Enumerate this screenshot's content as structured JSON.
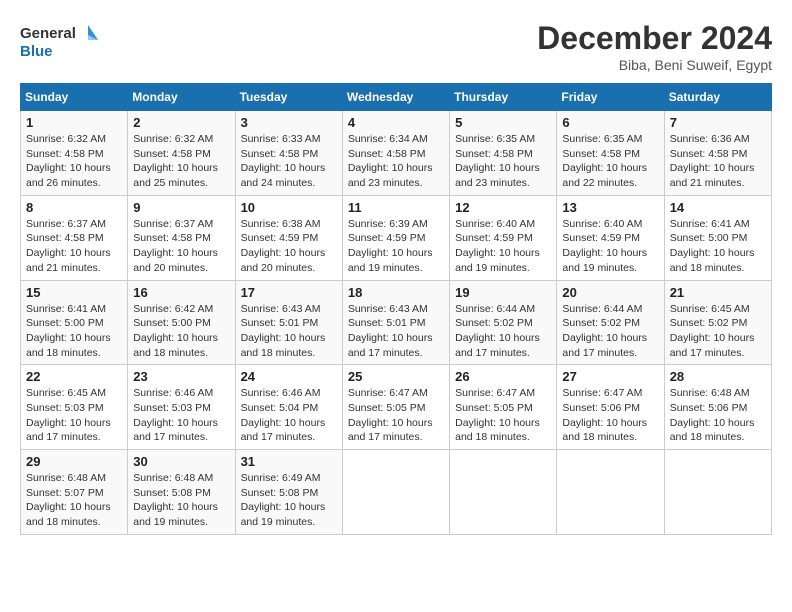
{
  "logo": {
    "line1": "General",
    "line2": "Blue"
  },
  "title": "December 2024",
  "location": "Biba, Beni Suweif, Egypt",
  "weekdays": [
    "Sunday",
    "Monday",
    "Tuesday",
    "Wednesday",
    "Thursday",
    "Friday",
    "Saturday"
  ],
  "weeks": [
    [
      {
        "day": "1",
        "sunrise": "6:32 AM",
        "sunset": "4:58 PM",
        "daylight": "10 hours and 26 minutes."
      },
      {
        "day": "2",
        "sunrise": "6:32 AM",
        "sunset": "4:58 PM",
        "daylight": "10 hours and 25 minutes."
      },
      {
        "day": "3",
        "sunrise": "6:33 AM",
        "sunset": "4:58 PM",
        "daylight": "10 hours and 24 minutes."
      },
      {
        "day": "4",
        "sunrise": "6:34 AM",
        "sunset": "4:58 PM",
        "daylight": "10 hours and 23 minutes."
      },
      {
        "day": "5",
        "sunrise": "6:35 AM",
        "sunset": "4:58 PM",
        "daylight": "10 hours and 23 minutes."
      },
      {
        "day": "6",
        "sunrise": "6:35 AM",
        "sunset": "4:58 PM",
        "daylight": "10 hours and 22 minutes."
      },
      {
        "day": "7",
        "sunrise": "6:36 AM",
        "sunset": "4:58 PM",
        "daylight": "10 hours and 21 minutes."
      }
    ],
    [
      {
        "day": "8",
        "sunrise": "6:37 AM",
        "sunset": "4:58 PM",
        "daylight": "10 hours and 21 minutes."
      },
      {
        "day": "9",
        "sunrise": "6:37 AM",
        "sunset": "4:58 PM",
        "daylight": "10 hours and 20 minutes."
      },
      {
        "day": "10",
        "sunrise": "6:38 AM",
        "sunset": "4:59 PM",
        "daylight": "10 hours and 20 minutes."
      },
      {
        "day": "11",
        "sunrise": "6:39 AM",
        "sunset": "4:59 PM",
        "daylight": "10 hours and 19 minutes."
      },
      {
        "day": "12",
        "sunrise": "6:40 AM",
        "sunset": "4:59 PM",
        "daylight": "10 hours and 19 minutes."
      },
      {
        "day": "13",
        "sunrise": "6:40 AM",
        "sunset": "4:59 PM",
        "daylight": "10 hours and 19 minutes."
      },
      {
        "day": "14",
        "sunrise": "6:41 AM",
        "sunset": "5:00 PM",
        "daylight": "10 hours and 18 minutes."
      }
    ],
    [
      {
        "day": "15",
        "sunrise": "6:41 AM",
        "sunset": "5:00 PM",
        "daylight": "10 hours and 18 minutes."
      },
      {
        "day": "16",
        "sunrise": "6:42 AM",
        "sunset": "5:00 PM",
        "daylight": "10 hours and 18 minutes."
      },
      {
        "day": "17",
        "sunrise": "6:43 AM",
        "sunset": "5:01 PM",
        "daylight": "10 hours and 18 minutes."
      },
      {
        "day": "18",
        "sunrise": "6:43 AM",
        "sunset": "5:01 PM",
        "daylight": "10 hours and 17 minutes."
      },
      {
        "day": "19",
        "sunrise": "6:44 AM",
        "sunset": "5:02 PM",
        "daylight": "10 hours and 17 minutes."
      },
      {
        "day": "20",
        "sunrise": "6:44 AM",
        "sunset": "5:02 PM",
        "daylight": "10 hours and 17 minutes."
      },
      {
        "day": "21",
        "sunrise": "6:45 AM",
        "sunset": "5:02 PM",
        "daylight": "10 hours and 17 minutes."
      }
    ],
    [
      {
        "day": "22",
        "sunrise": "6:45 AM",
        "sunset": "5:03 PM",
        "daylight": "10 hours and 17 minutes."
      },
      {
        "day": "23",
        "sunrise": "6:46 AM",
        "sunset": "5:03 PM",
        "daylight": "10 hours and 17 minutes."
      },
      {
        "day": "24",
        "sunrise": "6:46 AM",
        "sunset": "5:04 PM",
        "daylight": "10 hours and 17 minutes."
      },
      {
        "day": "25",
        "sunrise": "6:47 AM",
        "sunset": "5:05 PM",
        "daylight": "10 hours and 17 minutes."
      },
      {
        "day": "26",
        "sunrise": "6:47 AM",
        "sunset": "5:05 PM",
        "daylight": "10 hours and 18 minutes."
      },
      {
        "day": "27",
        "sunrise": "6:47 AM",
        "sunset": "5:06 PM",
        "daylight": "10 hours and 18 minutes."
      },
      {
        "day": "28",
        "sunrise": "6:48 AM",
        "sunset": "5:06 PM",
        "daylight": "10 hours and 18 minutes."
      }
    ],
    [
      {
        "day": "29",
        "sunrise": "6:48 AM",
        "sunset": "5:07 PM",
        "daylight": "10 hours and 18 minutes."
      },
      {
        "day": "30",
        "sunrise": "6:48 AM",
        "sunset": "5:08 PM",
        "daylight": "10 hours and 19 minutes."
      },
      {
        "day": "31",
        "sunrise": "6:49 AM",
        "sunset": "5:08 PM",
        "daylight": "10 hours and 19 minutes."
      },
      null,
      null,
      null,
      null
    ]
  ]
}
